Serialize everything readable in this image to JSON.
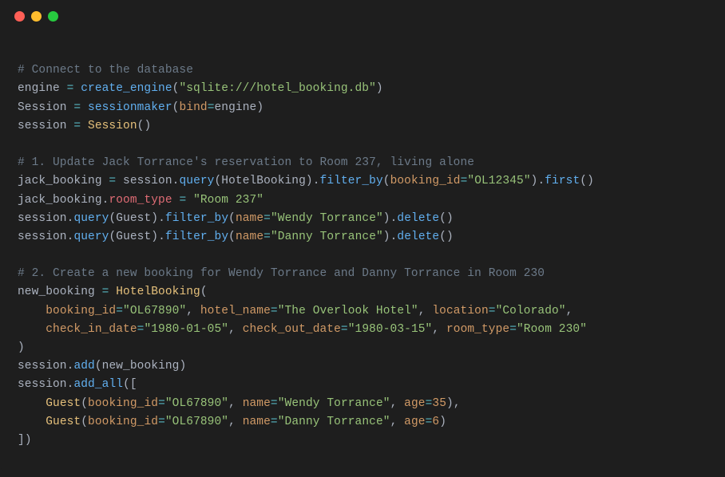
{
  "titlebar": {
    "red": "close",
    "yellow": "minimize",
    "green": "zoom"
  },
  "code": {
    "comment1": "# Connect to the database",
    "l2": {
      "engine": "engine",
      "eq": " = ",
      "fn": "create_engine",
      "lp": "(",
      "s": "\"sqlite:///hotel_booking.db\"",
      "rp": ")"
    },
    "l3": {
      "sess": "Session",
      "eq": " = ",
      "fn": "sessionmaker",
      "lp": "(",
      "p": "bind",
      "peq": "=",
      "v": "engine",
      "rp": ")"
    },
    "l4": {
      "s": "session",
      "eq": " = ",
      "fn": "Session",
      "lp": "(",
      "rp": ")"
    },
    "comment2": "# 1. Update Jack Torrance's reservation to Room 237, living alone",
    "l6": {
      "v": "jack_booking",
      "eq": " = ",
      "s": "session",
      "dot1": ".",
      "q": "query",
      "lp1": "(",
      "hb": "HotelBooking",
      "rp1": ")",
      "dot2": ".",
      "fb": "filter_by",
      "lp2": "(",
      "p": "booking_id",
      "peq": "=",
      "str": "\"OL12345\"",
      "rp2": ")",
      "dot3": ".",
      "fi": "first",
      "lp3": "(",
      "rp3": ")"
    },
    "l7": {
      "v": "jack_booking",
      "dot": ".",
      "rt": "room_type",
      "eq": " = ",
      "s": "\"Room 237\""
    },
    "l8": {
      "s": "session",
      "dot1": ".",
      "q": "query",
      "lp1": "(",
      "g": "Guest",
      "rp1": ")",
      "dot2": ".",
      "fb": "filter_by",
      "lp2": "(",
      "p": "name",
      "peq": "=",
      "str": "\"Wendy Torrance\"",
      "rp2": ")",
      "dot3": ".",
      "del": "delete",
      "lp3": "(",
      "rp3": ")"
    },
    "l9": {
      "s": "session",
      "dot1": ".",
      "q": "query",
      "lp1": "(",
      "g": "Guest",
      "rp1": ")",
      "dot2": ".",
      "fb": "filter_by",
      "lp2": "(",
      "p": "name",
      "peq": "=",
      "str": "\"Danny Torrance\"",
      "rp2": ")",
      "dot3": ".",
      "del": "delete",
      "lp3": "(",
      "rp3": ")"
    },
    "comment3": "# 2. Create a new booking for Wendy Torrance and Danny Torrance in Room 230",
    "l11": {
      "v": "new_booking",
      "eq": " = ",
      "fn": "HotelBooking",
      "lp": "("
    },
    "l12": {
      "indent": "    ",
      "p1": "booking_id",
      "eq1": "=",
      "s1": "\"OL67890\"",
      "c1": ", ",
      "p2": "hotel_name",
      "eq2": "=",
      "s2": "\"The Overlook Hotel\"",
      "c2": ", ",
      "p3": "location",
      "eq3": "=",
      "s3": "\"Colorado\"",
      "c3": ","
    },
    "l13": {
      "indent": "    ",
      "p1": "check_in_date",
      "eq1": "=",
      "s1": "\"1980-01-05\"",
      "c1": ", ",
      "p2": "check_out_date",
      "eq2": "=",
      "s2": "\"1980-03-15\"",
      "c2": ", ",
      "p3": "room_type",
      "eq3": "=",
      "s3": "\"Room 230\""
    },
    "l14": {
      "rp": ")"
    },
    "l15": {
      "s": "session",
      "dot": ".",
      "fn": "add",
      "lp": "(",
      "v": "new_booking",
      "rp": ")"
    },
    "l16": {
      "s": "session",
      "dot": ".",
      "fn": "add_all",
      "lp": "(",
      "lb": "["
    },
    "l17": {
      "indent": "    ",
      "fn": "Guest",
      "lp": "(",
      "p1": "booking_id",
      "eq1": "=",
      "s1": "\"OL67890\"",
      "c1": ", ",
      "p2": "name",
      "eq2": "=",
      "s2": "\"Wendy Torrance\"",
      "c2": ", ",
      "p3": "age",
      "eq3": "=",
      "n": "35",
      "rp": ")",
      "c3": ","
    },
    "l18": {
      "indent": "    ",
      "fn": "Guest",
      "lp": "(",
      "p1": "booking_id",
      "eq1": "=",
      "s1": "\"OL67890\"",
      "c1": ", ",
      "p2": "name",
      "eq2": "=",
      "s2": "\"Danny Torrance\"",
      "c2": ", ",
      "p3": "age",
      "eq3": "=",
      "n": "6",
      "rp": ")"
    },
    "l19": {
      "rb": "]",
      "rp": ")"
    }
  }
}
